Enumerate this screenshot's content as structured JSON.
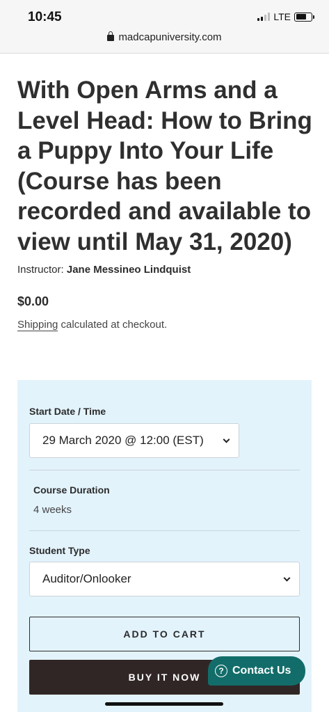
{
  "status_bar": {
    "time": "10:45",
    "network": "LTE",
    "url": "madcapuniversity.com"
  },
  "product": {
    "title": "With Open Arms and a Level Head:  How to Bring a Puppy Into Your Life (Course has been recorded and available to view until May 31, 2020)",
    "instructor_label": "Instructor:",
    "instructor_name": "Jane Messineo Lindquist",
    "price": "$0.00",
    "shipping_link": "Shipping",
    "shipping_text": " calculated at checkout."
  },
  "options": {
    "start_label": "Start Date / Time",
    "start_value": "29 March 2020 @ 12:00 (EST)",
    "duration_label": "Course Duration",
    "duration_value": "4 weeks",
    "student_label": "Student Type",
    "student_value": "Auditor/Onlooker"
  },
  "buttons": {
    "add_to_cart": "ADD TO CART",
    "buy_now": "BUY IT NOW"
  },
  "chat": {
    "label": "Contact Us",
    "color": "#126d6a"
  },
  "colors": {
    "panel_bg": "#e3f3fc",
    "buy_bg": "#312626"
  }
}
